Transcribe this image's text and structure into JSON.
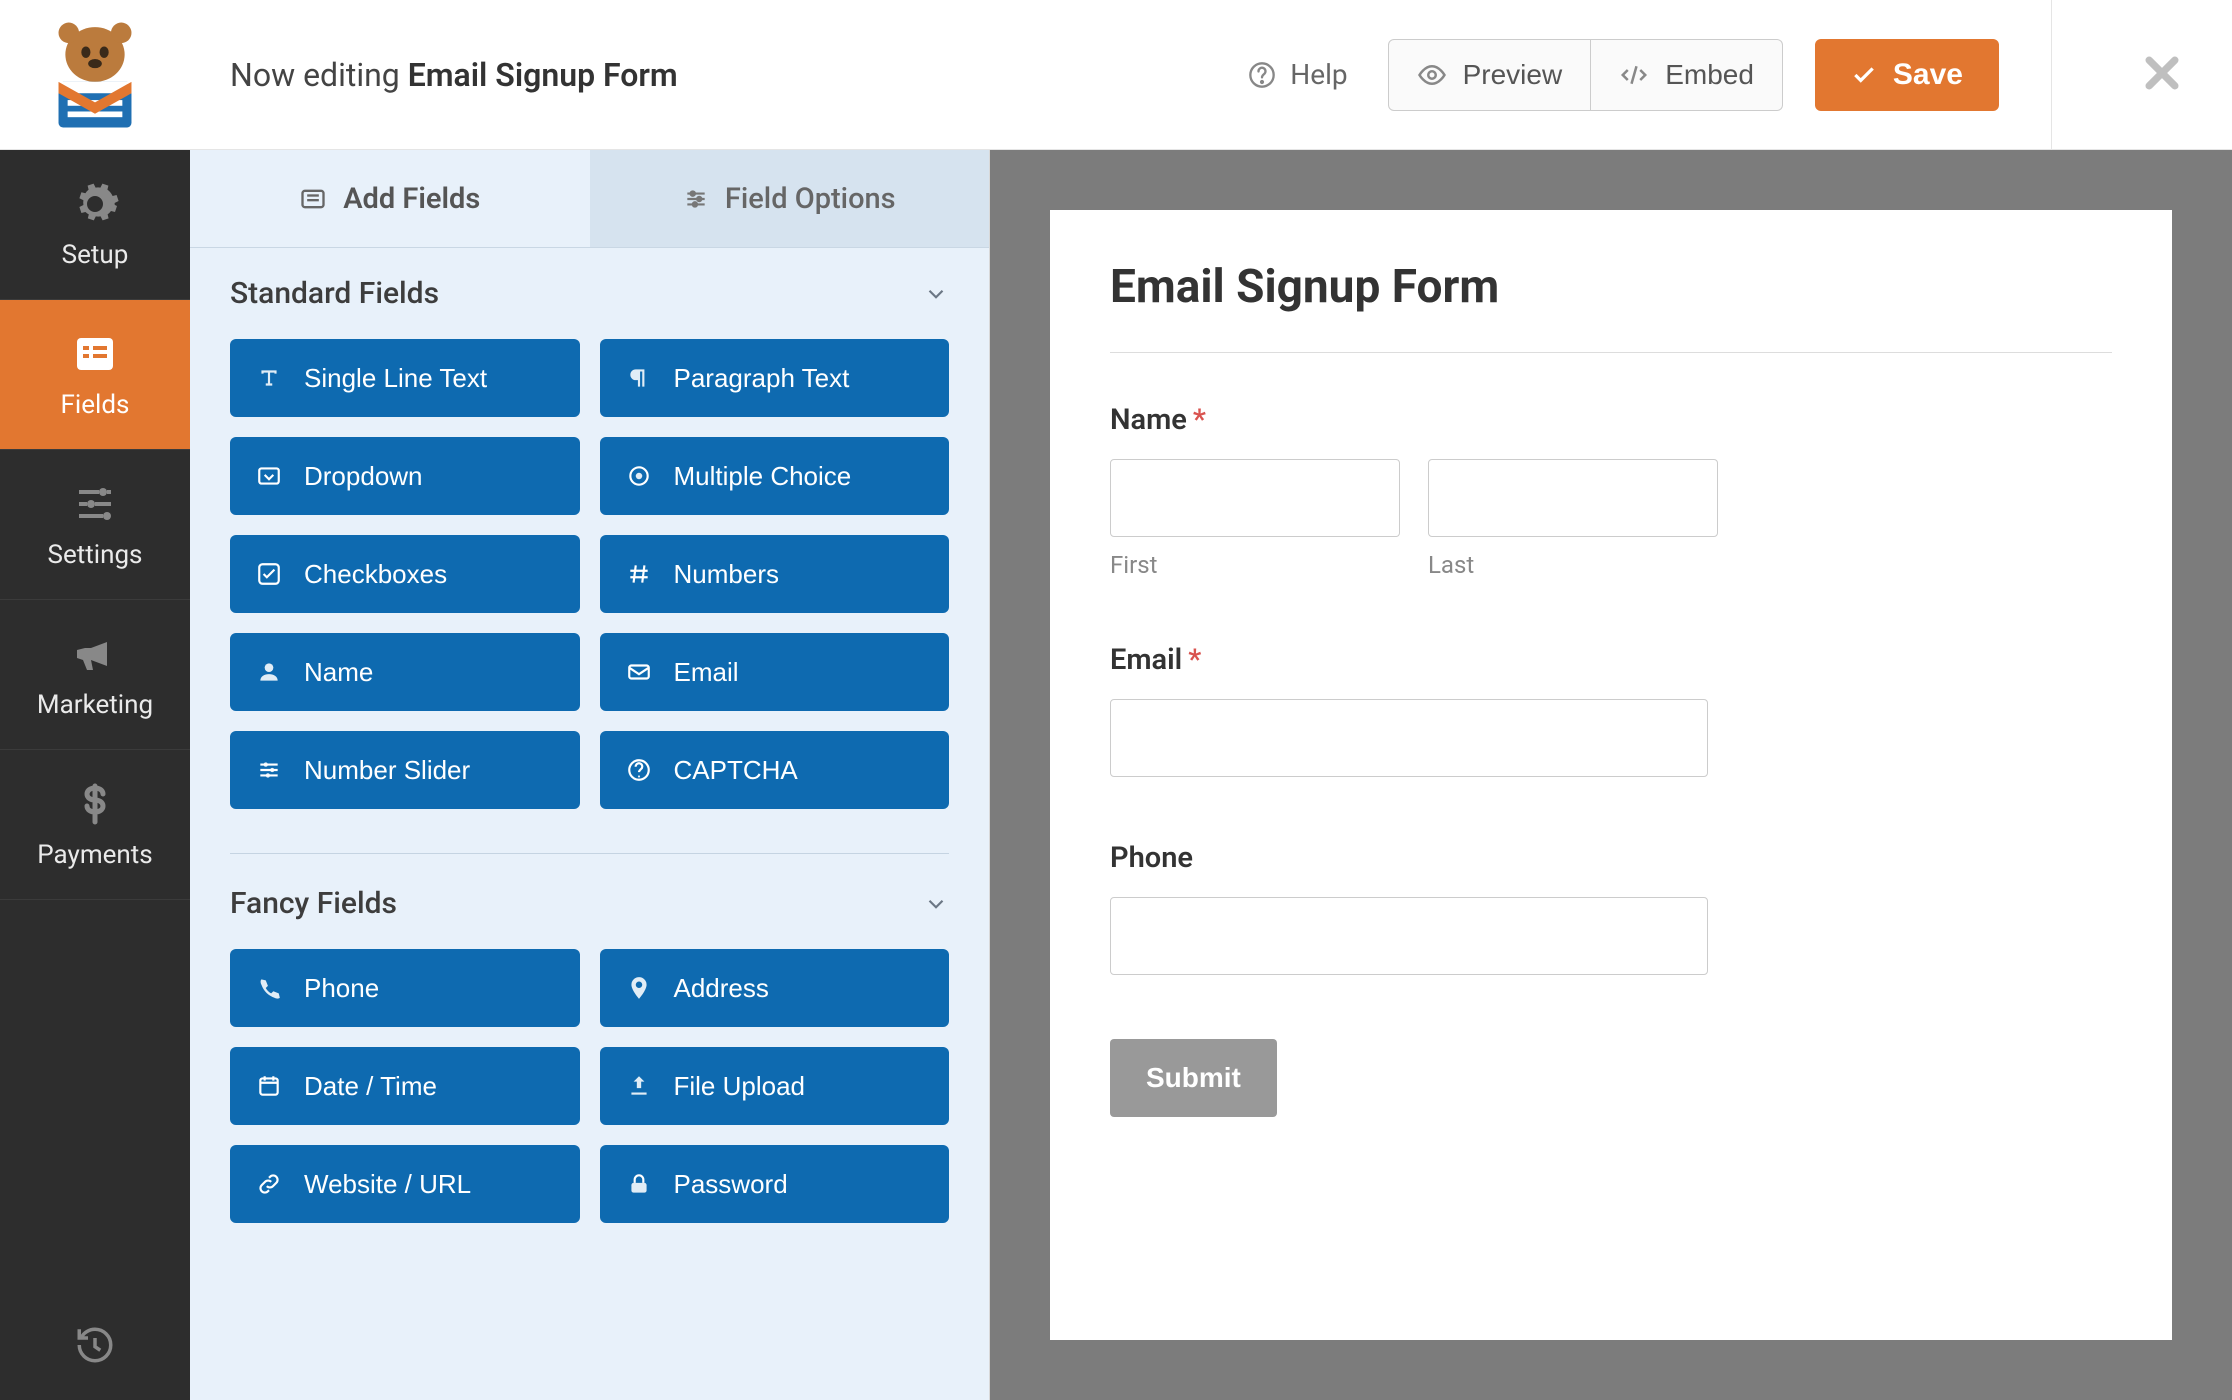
{
  "topbar": {
    "editing_prefix": "Now editing ",
    "form_name": "Email Signup Form",
    "help": "Help",
    "preview": "Preview",
    "embed": "Embed",
    "save": "Save"
  },
  "nav": {
    "setup": "Setup",
    "fields": "Fields",
    "settings": "Settings",
    "marketing": "Marketing",
    "payments": "Payments"
  },
  "panel": {
    "tab_add": "Add Fields",
    "tab_options": "Field Options",
    "standard_heading": "Standard Fields",
    "fancy_heading": "Fancy Fields",
    "standard": [
      {
        "icon": "text",
        "label": "Single Line Text"
      },
      {
        "icon": "paragraph",
        "label": "Paragraph Text"
      },
      {
        "icon": "dropdown",
        "label": "Dropdown"
      },
      {
        "icon": "radio",
        "label": "Multiple Choice"
      },
      {
        "icon": "check",
        "label": "Checkboxes"
      },
      {
        "icon": "hash",
        "label": "Numbers"
      },
      {
        "icon": "person",
        "label": "Name"
      },
      {
        "icon": "envelope",
        "label": "Email"
      },
      {
        "icon": "sliders",
        "label": "Number Slider"
      },
      {
        "icon": "question",
        "label": "CAPTCHA"
      }
    ],
    "fancy": [
      {
        "icon": "phone",
        "label": "Phone"
      },
      {
        "icon": "pin",
        "label": "Address"
      },
      {
        "icon": "calendar",
        "label": "Date / Time"
      },
      {
        "icon": "upload",
        "label": "File Upload"
      },
      {
        "icon": "link",
        "label": "Website / URL"
      },
      {
        "icon": "lock",
        "label": "Password"
      }
    ]
  },
  "form": {
    "title": "Email Signup Form",
    "name_label": "Name",
    "first_sub": "First",
    "last_sub": "Last",
    "email_label": "Email",
    "phone_label": "Phone",
    "submit": "Submit"
  }
}
